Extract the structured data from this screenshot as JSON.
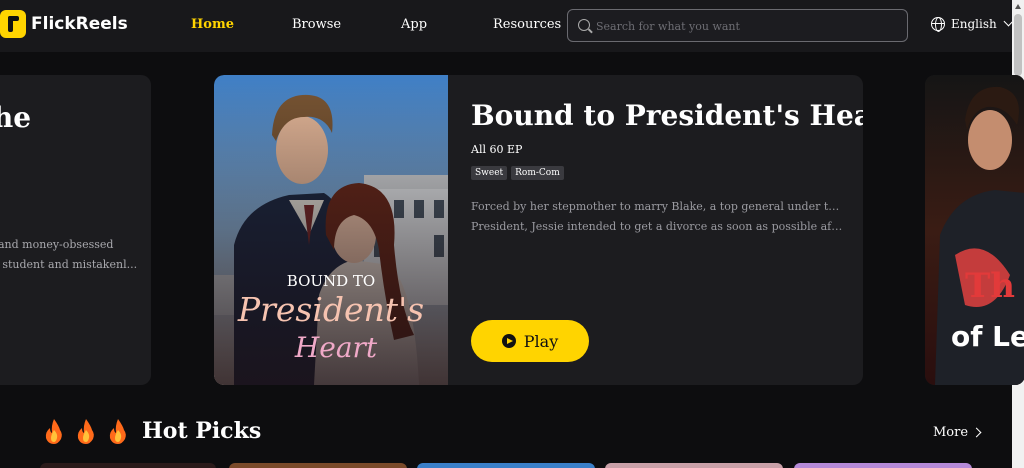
{
  "header": {
    "logo_text": "FlickReels",
    "nav": {
      "home": "Home",
      "browse": "Browse",
      "app": "App",
      "resources": "Resources"
    },
    "search_placeholder": "Search for what you want",
    "language": "English"
  },
  "carousel": {
    "prev": {
      "title_partial": "the",
      "desc_lines": [
        "and money-obsessed",
        "her student and mistakenl..."
      ]
    },
    "featured": {
      "title": "Bound to President's Heart",
      "episodes": "All 60 EP",
      "tags": [
        "Sweet",
        "Rom-Com"
      ],
      "description_lines": [
        "Forced by her stepmother to marry Blake, a top general under the US",
        "President, Jessie intended to get a divorce as soon as possible after he broug..."
      ],
      "poster_text_line1": "BOUND TO",
      "poster_text_line2": "President's",
      "poster_text_line3": "Heart",
      "play_label": "Play"
    },
    "next": {
      "poster_text_line1": "Th",
      "poster_text_line2": "of Le"
    }
  },
  "hot_picks": {
    "title": "Hot Picks",
    "more_label": "More"
  },
  "colors": {
    "accent": "#ffd400",
    "background": "#0d0d0f",
    "header": "#18181b",
    "card": "#1c1c1f"
  }
}
